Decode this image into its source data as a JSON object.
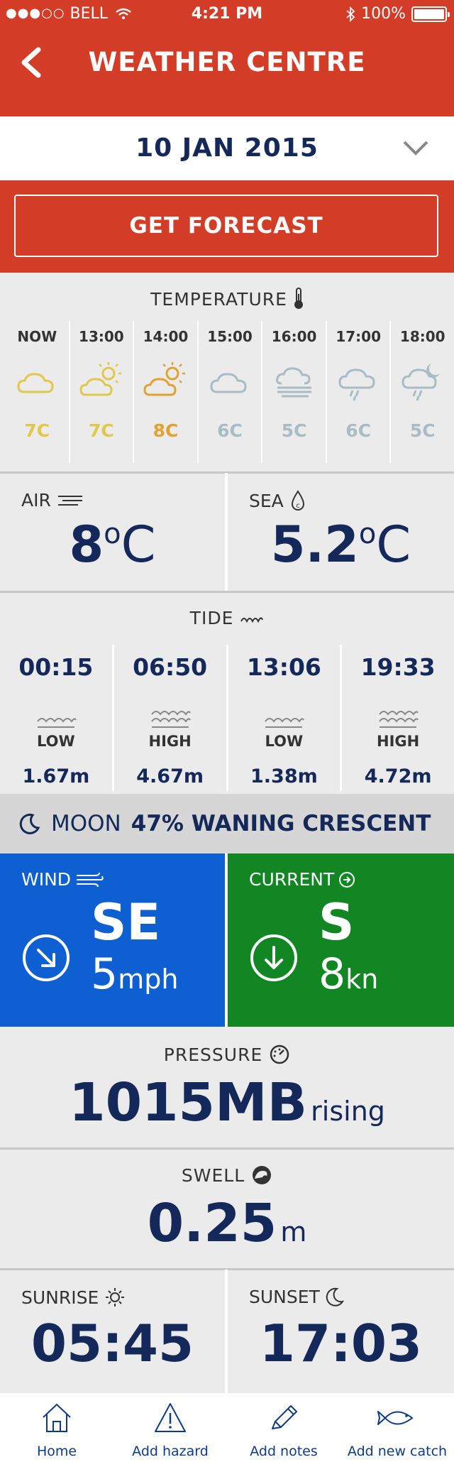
{
  "status_bar": {
    "signal_dots": "●●●○○",
    "carrier": "BELL",
    "time": "4:21 PM",
    "battery": "100%"
  },
  "header": {
    "title": "WEATHER CENTRE"
  },
  "date_selector": {
    "value": "10 JAN 2015"
  },
  "forecast_button": {
    "label": "GET FORECAST"
  },
  "temperature": {
    "label": "TEMPERATURE",
    "hours": [
      {
        "time": "NOW",
        "icon": "cloud-icon",
        "value": "7C",
        "color": "#e2c84a"
      },
      {
        "time": "13:00",
        "icon": "sun-cloud-icon",
        "value": "7C",
        "color": "#e2c84a"
      },
      {
        "time": "14:00",
        "icon": "sun-cloud-icon",
        "value": "8C",
        "color": "#e0a332"
      },
      {
        "time": "15:00",
        "icon": "cloud-icon",
        "value": "6C",
        "color": "#a9bcc4"
      },
      {
        "time": "16:00",
        "icon": "fog-icon",
        "value": "5C",
        "color": "#a9bcc4"
      },
      {
        "time": "17:00",
        "icon": "rain-cloud-icon",
        "value": "6C",
        "color": "#a9bcc4"
      },
      {
        "time": "18:00",
        "icon": "night-rain-icon",
        "value": "5C",
        "color": "#a9bcc4"
      }
    ]
  },
  "air": {
    "label": "AIR",
    "value": "8",
    "unit": "C"
  },
  "sea": {
    "label": "SEA",
    "value": "5.2",
    "unit": "C"
  },
  "tide": {
    "label": "TIDE",
    "entries": [
      {
        "time": "00:15",
        "type": "LOW",
        "height": "1.67m"
      },
      {
        "time": "06:50",
        "type": "HIGH",
        "height": "4.67m"
      },
      {
        "time": "13:06",
        "type": "LOW",
        "height": "1.38m"
      },
      {
        "time": "19:33",
        "type": "HIGH",
        "height": "4.72m"
      }
    ]
  },
  "moon": {
    "label": "MOON",
    "value": "47% WANING CRESCENT"
  },
  "wind": {
    "label": "WIND",
    "direction": "SE",
    "speed": "5",
    "unit": "mph",
    "color": "#0e5fd1"
  },
  "current": {
    "label": "CURRENT",
    "direction": "S",
    "speed": "8",
    "unit": "kn",
    "color": "#138624"
  },
  "pressure": {
    "label": "PRESSURE",
    "value": "1015MB",
    "trend": "rising"
  },
  "swell": {
    "label": "SWELL",
    "value": "0.25",
    "unit": "m"
  },
  "sunrise": {
    "label": "SUNRISE",
    "time": "05:45"
  },
  "sunset": {
    "label": "SUNSET",
    "time": "17:03"
  },
  "tabbar": {
    "items": [
      {
        "label": "Home",
        "icon": "home-icon"
      },
      {
        "label": "Add hazard",
        "icon": "warning-icon"
      },
      {
        "label": "Add notes",
        "icon": "pencil-icon"
      },
      {
        "label": "Add new catch",
        "icon": "fish-icon"
      }
    ]
  }
}
